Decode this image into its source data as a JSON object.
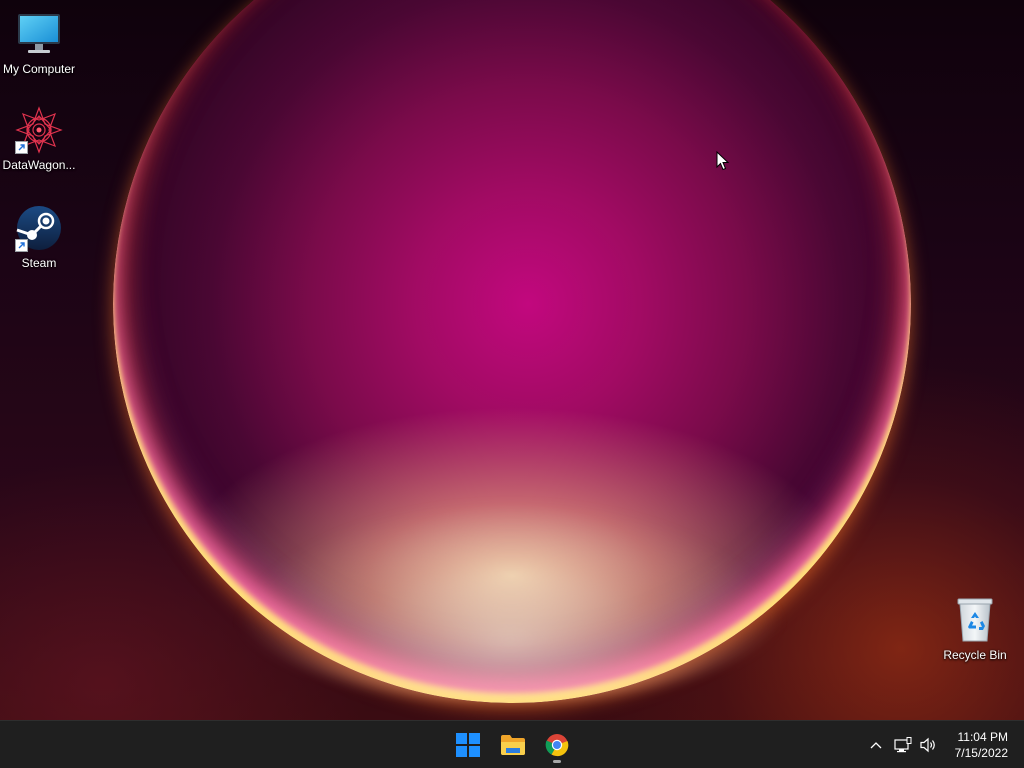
{
  "desktop": {
    "icons": [
      {
        "label": "My Computer",
        "icon": "monitor-icon"
      },
      {
        "label": "DataWagon...",
        "icon": "datawagon-mandala-icon",
        "shortcut": true
      },
      {
        "label": "Steam",
        "icon": "steam-icon",
        "shortcut": true
      },
      {
        "label": "Recycle Bin",
        "icon": "recycle-bin-icon"
      }
    ]
  },
  "taskbar": {
    "apps": [
      {
        "name": "Start",
        "icon": "windows-start-icon"
      },
      {
        "name": "File Explorer",
        "icon": "folder-icon"
      },
      {
        "name": "Google Chrome",
        "icon": "chrome-icon",
        "running": true
      }
    ],
    "tray": {
      "overflow_icon": "chevron-up-icon",
      "network_icon": "network-icon",
      "volume_icon": "speaker-icon"
    },
    "clock": {
      "time": "11:04 PM",
      "date": "7/15/2022"
    }
  },
  "colors": {
    "taskbar_bg": "#1f1f1f",
    "start_blue": "#1e90ff",
    "folder_yellow": "#f5c33b"
  }
}
